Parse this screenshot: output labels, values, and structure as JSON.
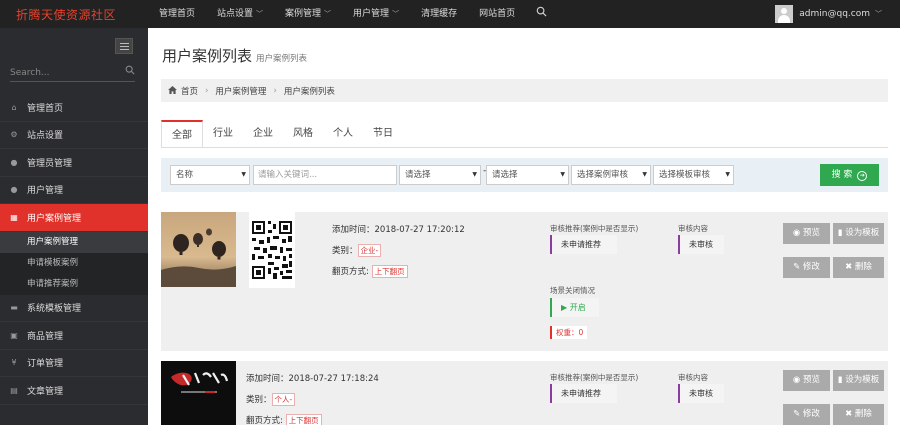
{
  "brand": "折腾天使资源社区",
  "nav": {
    "items": [
      {
        "label": "管理首页",
        "dropdown": false
      },
      {
        "label": "站点设置",
        "dropdown": true
      },
      {
        "label": "案例管理",
        "dropdown": true
      },
      {
        "label": "用户管理",
        "dropdown": true
      },
      {
        "label": "清理缓存",
        "dropdown": false
      },
      {
        "label": "网站首页",
        "dropdown": false
      }
    ],
    "search_icon": "search-icon",
    "user_email": "admin@qq.com"
  },
  "sidebar": {
    "search_placeholder": "Search...",
    "items": [
      {
        "label": "管理首页",
        "icon": "home-icon",
        "glyph": "⌂"
      },
      {
        "label": "站点设置",
        "icon": "gears-icon",
        "glyph": "⚙"
      },
      {
        "label": "管理员管理",
        "icon": "user-icon",
        "glyph": "●"
      },
      {
        "label": "用户管理",
        "icon": "user-icon",
        "glyph": "●"
      },
      {
        "label": "用户案例管理",
        "icon": "table-icon",
        "glyph": "▦",
        "active": true
      },
      {
        "label": "系统模板管理",
        "icon": "briefcase-icon",
        "glyph": "▬"
      },
      {
        "label": "商品管理",
        "icon": "box-icon",
        "glyph": "▣"
      },
      {
        "label": "订单管理",
        "icon": "yen-icon",
        "glyph": "¥"
      },
      {
        "label": "文章管理",
        "icon": "doc-icon",
        "glyph": "▤"
      }
    ],
    "sub_items": [
      {
        "label": "用户案例管理",
        "active": true
      },
      {
        "label": "申请模板案例"
      },
      {
        "label": "申请推荐案例"
      }
    ]
  },
  "page": {
    "title": "用户案例列表",
    "subtitle": "用户案例列表",
    "breadcrumb": [
      "首页",
      "用户案例管理",
      "用户案例列表"
    ]
  },
  "tabs": [
    "全部",
    "行业",
    "企业",
    "风格",
    "个人",
    "节日"
  ],
  "filter": {
    "field_select": "名称",
    "keyword_placeholder": "请输入关键词...",
    "select_a": "请选择",
    "select_b": "请选择",
    "select_case_review": "选择案例审核",
    "select_template_review": "选择模板审核",
    "search_label": "搜 索"
  },
  "cases": [
    {
      "added_label": "添加时间：",
      "added_time": "2018-07-27 17:20:12",
      "category_label": "类别：",
      "category": "企业-",
      "paging_label": "翻页方式:",
      "paging": "上下翻页",
      "recommend_label": "审核推荐(案例中是否显示)",
      "recommend_status": "未申请推荐",
      "review_label": "审核内容",
      "review_status": "未审核",
      "scene_label": "场景关闭情况",
      "scene_status": "▶ 开启",
      "weight": "权重：0",
      "actions": {
        "preview": "预览",
        "set_template": "设为模板",
        "edit": "修改",
        "delete": "删除"
      }
    },
    {
      "added_label": "添加时间：",
      "added_time": "2018-07-27 17:18:24",
      "category_label": "类别：",
      "category": "个人-",
      "paging_label": "翻页方式:",
      "paging": "上下翻页",
      "recommend_label": "审核推荐(案例中是否显示)",
      "recommend_status": "未申请推荐",
      "review_label": "审核内容",
      "review_status": "未审核",
      "actions": {
        "preview": "预览",
        "set_template": "设为模板",
        "edit": "修改",
        "delete": "删除"
      }
    }
  ]
}
